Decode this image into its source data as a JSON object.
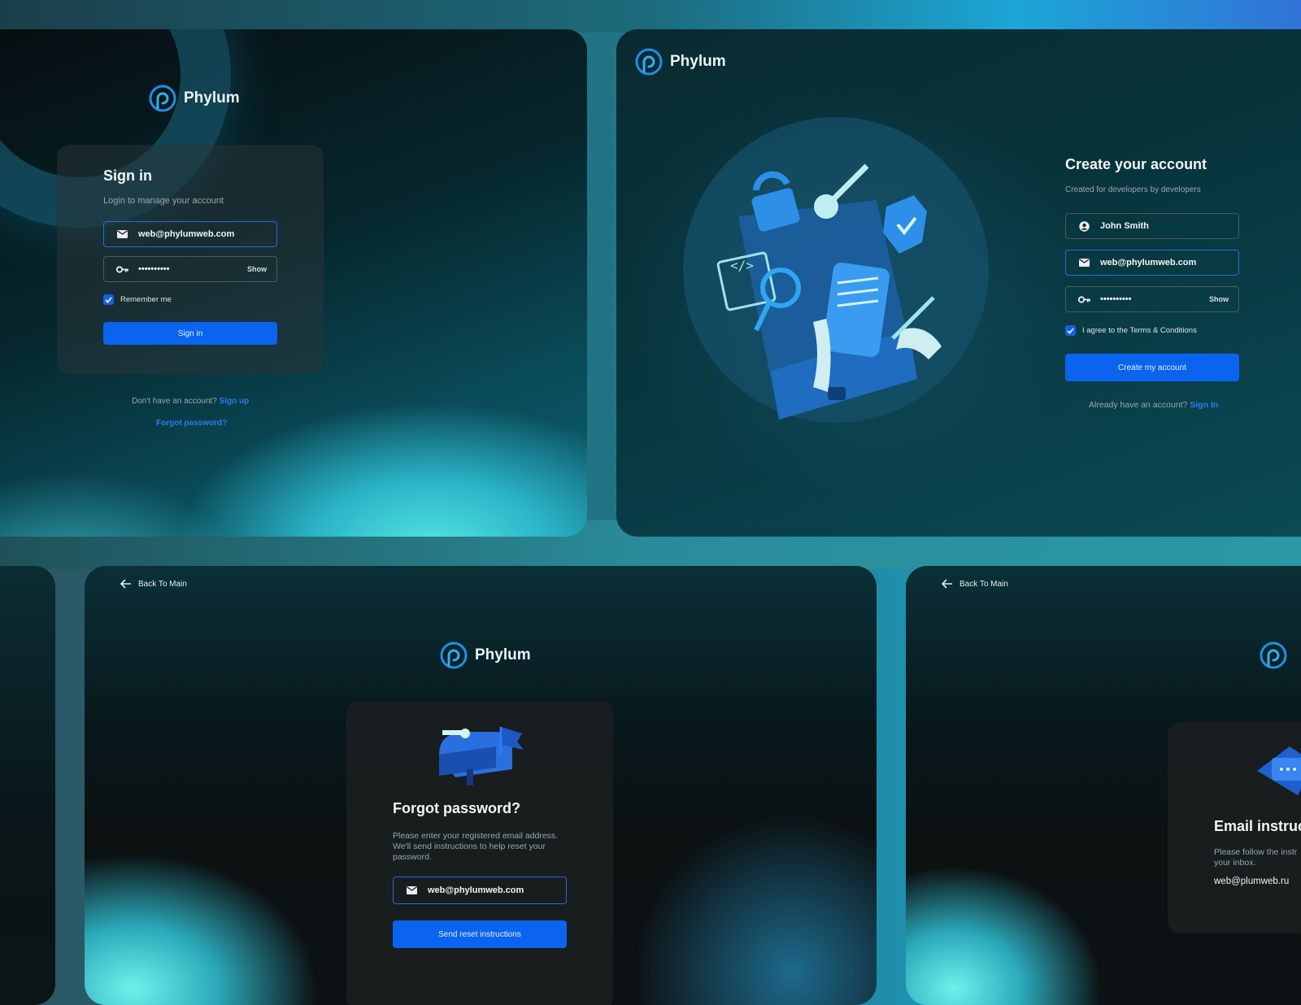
{
  "brand": {
    "name": "Phylum"
  },
  "signin": {
    "title": "Sign in",
    "subtitle": "Login to manage your account",
    "email_value": "web@phylumweb.com",
    "password_value": "••••••••••",
    "show_label": "Show",
    "remember_label": "Remember me",
    "remember_checked": true,
    "button_label": "Sign in",
    "no_account_text": "Don't have an account?",
    "signup_link": "Sign up",
    "forgot_link": "Forgot password?"
  },
  "create_account": {
    "title": "Create your account",
    "subtitle": "Created for developers by developers",
    "name_value": "John Smith",
    "email_value": "web@phylumweb.com",
    "password_value": "••••••••••",
    "show_label": "Show",
    "terms_label": "I agree to the Terms & Conditions",
    "terms_checked": true,
    "button_label": "Create my account",
    "have_account_text": "Already have an account?",
    "signin_link": "Sign In"
  },
  "forgot": {
    "back_label": "Back To Main",
    "title": "Forgot password?",
    "description": "Please enter your registered email address. We'll send instructions to help reset your password.",
    "email_value": "web@phylumweb.com",
    "button_label": "Send reset instructions"
  },
  "email_sent": {
    "back_label": "Back To Main",
    "title": "Email instruct",
    "description": "Please follow the instr your inbox.",
    "email_value": "web@plumweb.ru"
  },
  "colors": {
    "accent": "#0b64f0",
    "link": "#2f7cf0",
    "logo": "#1e8fe8"
  },
  "icons": [
    "phylum-logo-icon",
    "mail-icon",
    "key-icon",
    "user-icon",
    "check-icon",
    "arrow-left-icon"
  ]
}
